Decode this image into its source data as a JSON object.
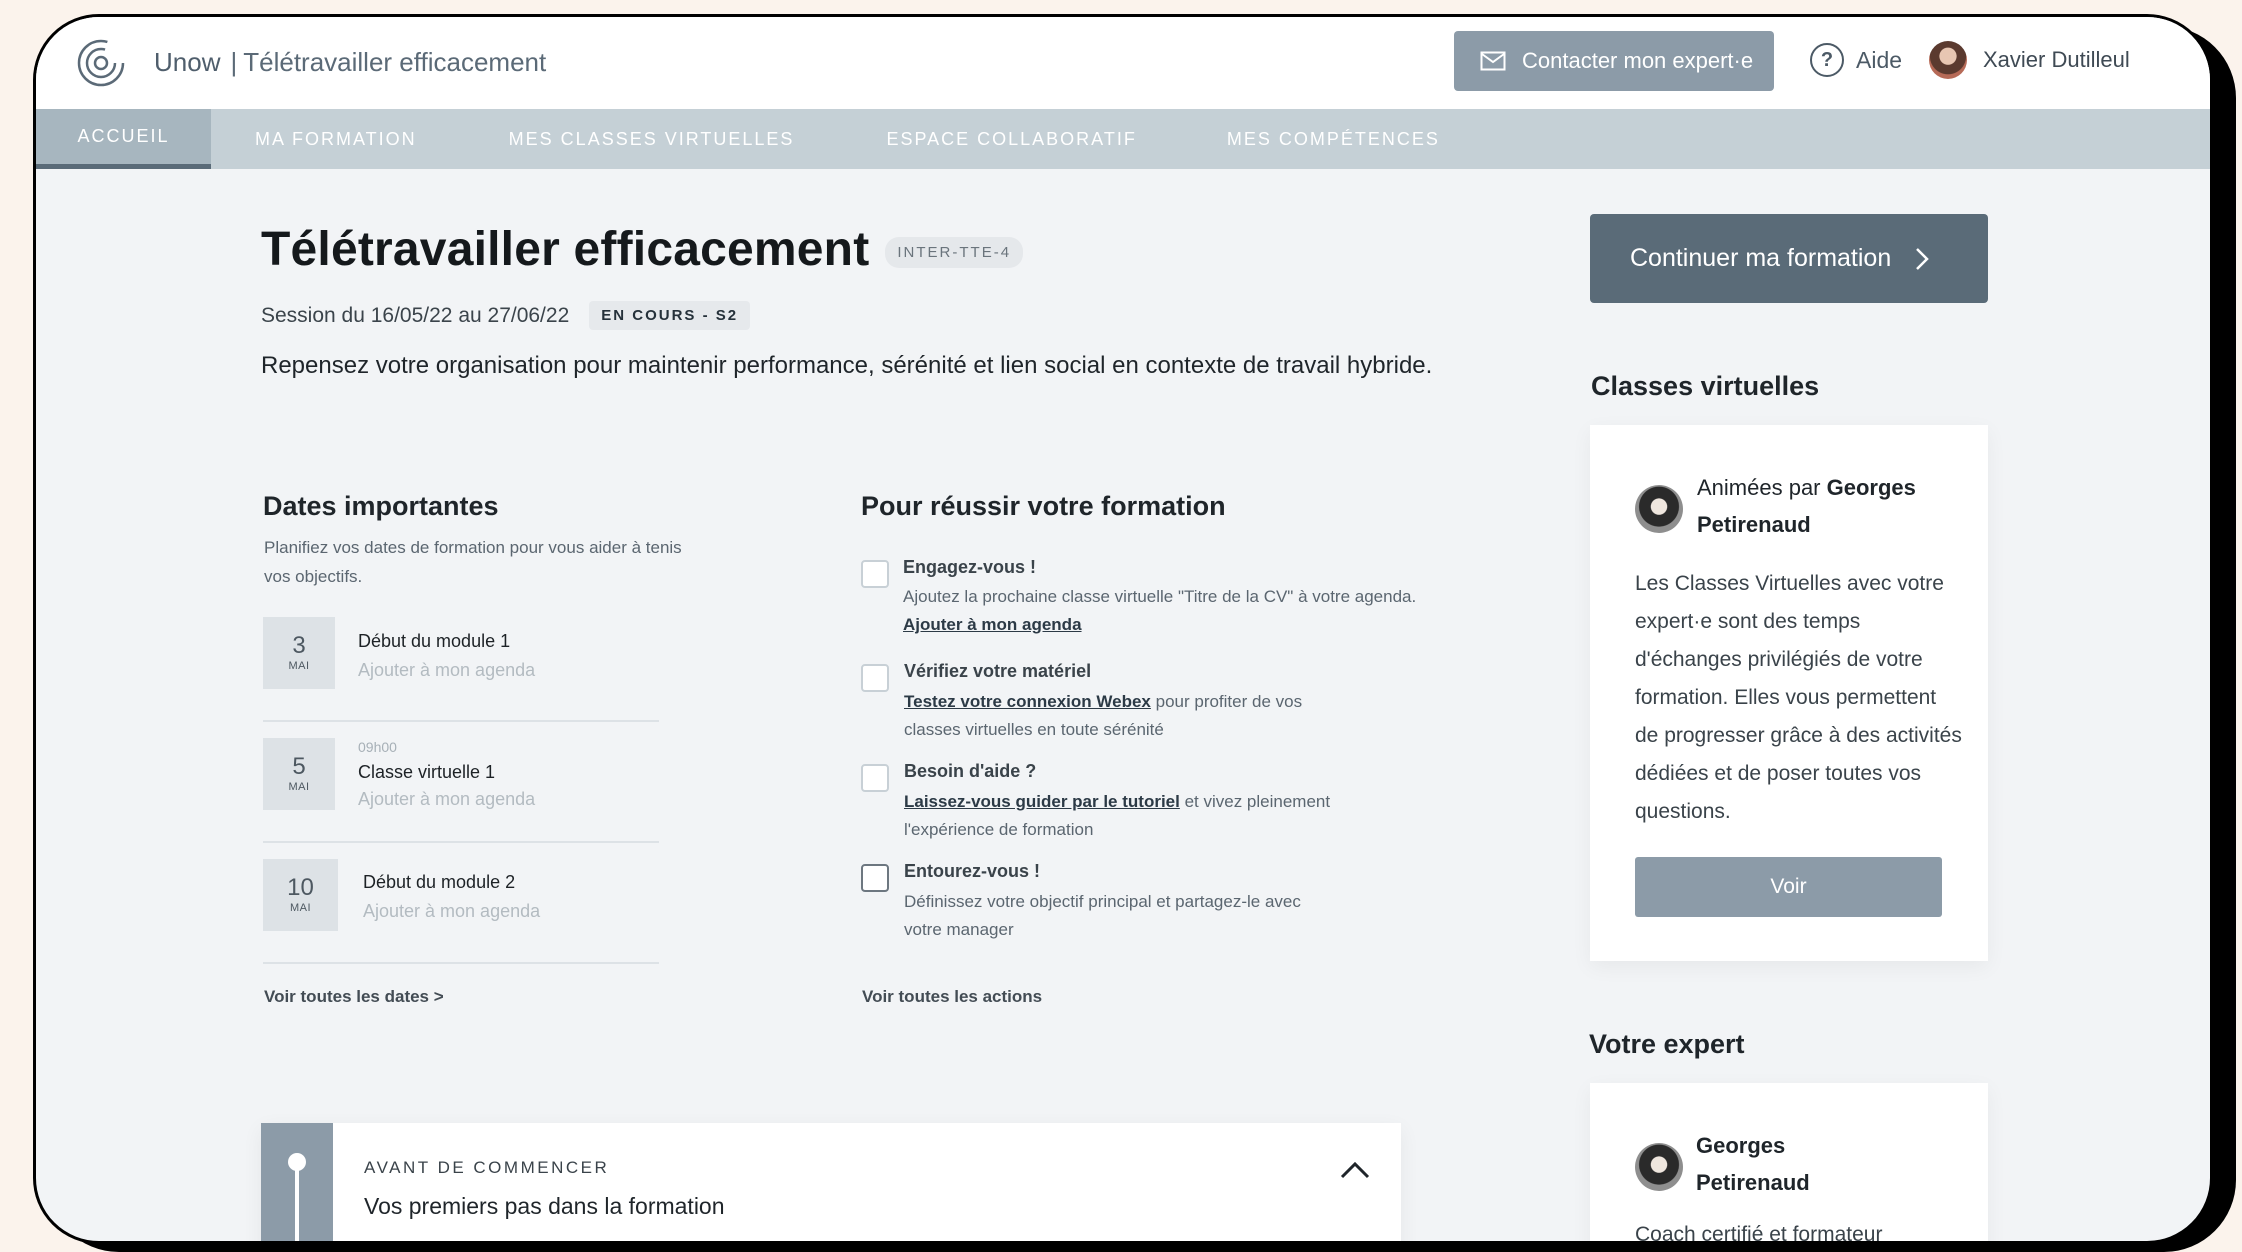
{
  "header": {
    "brand": "Unow",
    "separator": "|",
    "course_name": "Télétravailler efficacement",
    "contact_button": "Contacter mon expert·e",
    "help_label": "Aide",
    "user_name": "Xavier Dutilleul"
  },
  "nav": {
    "items": [
      {
        "label": "ACCUEIL",
        "active": true
      },
      {
        "label": "MA FORMATION",
        "active": false
      },
      {
        "label": "MES CLASSES VIRTUELLES",
        "active": false
      },
      {
        "label": "ESPACE COLLABORATIF",
        "active": false
      },
      {
        "label": "MES COMPÉTENCES",
        "active": false
      }
    ]
  },
  "main": {
    "title": "Télétravailler efficacement",
    "code": "INTER-TTE-4",
    "session": "Session du 16/05/22 au 27/06/22",
    "status": "EN COURS - S2",
    "description": "Repensez votre organisation pour maintenir performance, sérénité et lien social en contexte de travail hybride."
  },
  "dates": {
    "title": "Dates importantes",
    "subtitle": "Planifiez vos dates de formation pour vous aider à tenis vos objectifs.",
    "items": [
      {
        "day": "3",
        "month": "MAI",
        "time": "",
        "label": "Début du module 1",
        "link": "Ajouter à mon agenda"
      },
      {
        "day": "5",
        "month": "MAI",
        "time": "09h00",
        "label": "Classe virtuelle 1",
        "link": "Ajouter à mon agenda"
      },
      {
        "day": "10",
        "month": "MAI",
        "time": "",
        "label": "Début du module 2",
        "link": "Ajouter à mon agenda"
      }
    ],
    "see_all": "Voir toutes les dates >"
  },
  "actions": {
    "title": "Pour réussir votre formation",
    "items": [
      {
        "title": "Engagez-vous !",
        "line1": "Ajoutez la prochaine classe virtuelle \"Titre de la CV\" à votre agenda.",
        "link": "Ajouter à mon agenda"
      },
      {
        "title": "Vérifiez votre matériel",
        "link": "Testez votre connexion Webex",
        "after": " pour profiter de vos",
        "line2": "classes virtuelles en toute sérénité"
      },
      {
        "title": "Besoin d'aide ?",
        "link": "Laissez-vous guider par le tutoriel",
        "after": " et vivez pleinement",
        "line2": "l'expérience de formation"
      },
      {
        "title": "Entourez-vous !",
        "line1": "Définissez votre objectif principal et partagez-le avec",
        "line2": "votre manager"
      }
    ],
    "see_all": "Voir toutes les actions"
  },
  "accordion": {
    "kicker": "AVANT DE COMMENCER",
    "title": "Vos premiers pas dans la formation"
  },
  "sidebar": {
    "continue_button": "Continuer ma formation",
    "virtual_classes": {
      "title": "Classes virtuelles",
      "animated_by": "Animées par ",
      "expert_first": "Georges",
      "expert_last": "Petirenaud",
      "description": "Les Classes Virtuelles avec votre expert·e sont des temps d'échanges privilégiés de votre formation. Elles vous permettent de progresser grâce à des activités dédiées et de poser toutes vos questions.",
      "button": "Voir"
    },
    "expert": {
      "title": "Votre expert",
      "first_name": "Georges",
      "last_name": "Petirenaud",
      "description": "Coach certifié et formateur"
    }
  },
  "colors": {
    "nav_background": "#c5d0d6",
    "primary_button": "#5a6b78",
    "secondary_button": "#8c9ba8",
    "page_background": "#f2f4f6"
  }
}
